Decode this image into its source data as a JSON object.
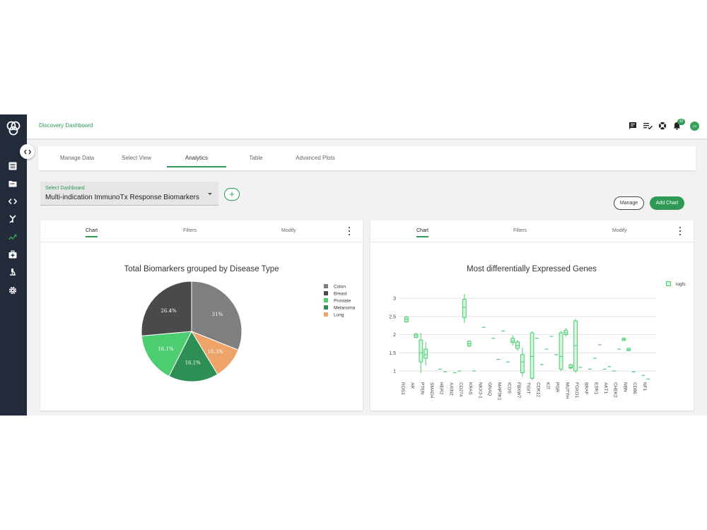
{
  "header": {
    "breadcrumb": "Discovery Dashboard",
    "notification_count": "93",
    "avatar_initials": "CD"
  },
  "tabs": [
    "Manage Data",
    "Select View",
    "Analytics",
    "Table",
    "Advanced Plots"
  ],
  "active_tab": "Analytics",
  "dashboard_select": {
    "label": "Select Dashboard",
    "value": "Multi-indication ImmunoTx Response Biomarkers"
  },
  "buttons": {
    "add_dashboard": "+",
    "manage": "Manage",
    "add_chart": "Add Chart"
  },
  "panel_tabs": {
    "chart": "Chart",
    "filters": "Filters",
    "modify": "Modify"
  },
  "colors": {
    "accent": "#2e9a55",
    "sidebar": "#232a3a"
  },
  "chart_data": [
    {
      "type": "pie",
      "title": "Total Biomarkers grouped by Disease Type",
      "labels": [
        "Colon",
        "Breast",
        "Prostate",
        "Melanoma",
        "Lung"
      ],
      "values": [
        31,
        26.4,
        16.1,
        16.1,
        10.3
      ],
      "slice_labels": [
        "31%",
        "26.4%",
        "16.1%",
        "16.1%",
        "10.3%"
      ],
      "slice_order": [
        "Colon",
        "Lung",
        "Melanoma",
        "Prostate",
        "Breast"
      ],
      "colors": {
        "Colon": "#7f7f7f",
        "Breast": "#4a4a4a",
        "Prostate": "#4ccd70",
        "Melanoma": "#2e8f55",
        "Lung": "#eea368"
      },
      "legend_position": "right"
    },
    {
      "type": "box",
      "title": "Most differentially Expressed Genes",
      "series_name": "logfc",
      "legend_position": "top-right",
      "ylim": [
        0.6,
        3.25
      ],
      "yticks": [
        1,
        1.5,
        2,
        2.5,
        3
      ],
      "ytick_labels": [
        "1",
        "1.5",
        "2",
        "2.5",
        "3"
      ],
      "categories": [
        "ROS1",
        "AR",
        "PTEN",
        "SMAD4",
        "HER2",
        "AXIN2",
        "CD274",
        "KRAS",
        "NKX3-1",
        "GNAQ",
        "MAP3K1",
        "ICOS",
        "FBXW7",
        "TIGIT",
        "CDK12",
        "KIT",
        "PGR",
        "MUTYH",
        "FOXO1",
        "BRAF",
        "ESR1",
        "AKT1",
        "CHEK2",
        "NBN",
        "CD86",
        "NF1"
      ],
      "boxes": [
        {
          "x": 0.5,
          "min": 2.32,
          "q1": 2.35,
          "median": 2.42,
          "q3": 2.48,
          "max": 2.52
        },
        {
          "x": 1.5,
          "min": 1.9,
          "q1": 1.92,
          "median": 1.97,
          "q3": 2.02,
          "max": 2.05
        },
        {
          "x": 2,
          "min": 0.95,
          "q1": 1.25,
          "median": 1.5,
          "q3": 1.85,
          "max": 2.05
        },
        {
          "x": 2.5,
          "min": 1.15,
          "q1": 1.35,
          "median": 1.45,
          "q3": 1.6,
          "max": 1.8
        },
        {
          "x": 4,
          "min": 1.05,
          "q1": 1.05,
          "median": 1.05,
          "q3": 1.05,
          "max": 1.05
        },
        {
          "x": 4.5,
          "min": 0.98,
          "q1": 0.98,
          "median": 0.98,
          "q3": 0.98,
          "max": 0.98
        },
        {
          "x": 5.5,
          "min": 0.95,
          "q1": 0.95,
          "median": 0.95,
          "q3": 0.95,
          "max": 0.95
        },
        {
          "x": 6,
          "min": 1.0,
          "q1": 1.0,
          "median": 1.0,
          "q3": 1.0,
          "max": 1.0
        },
        {
          "x": 6.5,
          "min": 2.32,
          "q1": 2.47,
          "median": 2.75,
          "q3": 2.97,
          "max": 3.12
        },
        {
          "x": 7,
          "min": 1.65,
          "q1": 1.69,
          "median": 1.75,
          "q3": 1.82,
          "max": 1.84
        },
        {
          "x": 7.5,
          "min": 1.0,
          "q1": 1.0,
          "median": 1.0,
          "q3": 1.0,
          "max": 1.0
        },
        {
          "x": 8.5,
          "min": 2.2,
          "q1": 2.2,
          "median": 2.2,
          "q3": 2.2,
          "max": 2.2
        },
        {
          "x": 9.5,
          "min": 1.9,
          "q1": 1.9,
          "median": 1.9,
          "q3": 1.9,
          "max": 1.9
        },
        {
          "x": 10,
          "min": 1.32,
          "q1": 1.32,
          "median": 1.32,
          "q3": 1.32,
          "max": 1.32
        },
        {
          "x": 10.5,
          "min": 2.1,
          "q1": 2.1,
          "median": 2.1,
          "q3": 2.1,
          "max": 2.1
        },
        {
          "x": 11,
          "min": 1.25,
          "q1": 1.25,
          "median": 1.25,
          "q3": 1.25,
          "max": 1.25
        },
        {
          "x": 11.5,
          "min": 1.7,
          "q1": 1.78,
          "median": 1.82,
          "q3": 1.9,
          "max": 1.98
        },
        {
          "x": 12,
          "min": 1.55,
          "q1": 1.62,
          "median": 1.7,
          "q3": 1.8,
          "max": 1.85
        },
        {
          "x": 12.5,
          "min": 0.85,
          "q1": 0.95,
          "median": 1.25,
          "q3": 1.45,
          "max": 1.65
        },
        {
          "x": 13.5,
          "min": 0.75,
          "q1": 0.8,
          "median": 1.4,
          "q3": 2.05,
          "max": 2.08
        },
        {
          "x": 14,
          "min": 1.9,
          "q1": 1.9,
          "median": 1.9,
          "q3": 1.9,
          "max": 1.9
        },
        {
          "x": 14.5,
          "min": 1.18,
          "q1": 1.18,
          "median": 1.18,
          "q3": 1.18,
          "max": 1.18
        },
        {
          "x": 15,
          "min": 1.6,
          "q1": 1.6,
          "median": 1.6,
          "q3": 1.6,
          "max": 1.6
        },
        {
          "x": 15.5,
          "min": 1.95,
          "q1": 1.95,
          "median": 1.95,
          "q3": 1.95,
          "max": 1.95
        },
        {
          "x": 16,
          "min": 1.45,
          "q1": 1.45,
          "median": 1.45,
          "q3": 1.45,
          "max": 1.45
        },
        {
          "x": 16.5,
          "min": 1.0,
          "q1": 1.05,
          "median": 1.4,
          "q3": 2.05,
          "max": 2.1
        },
        {
          "x": 17,
          "min": 1.95,
          "q1": 2.0,
          "median": 2.05,
          "q3": 2.12,
          "max": 2.18
        },
        {
          "x": 17.5,
          "min": 1.05,
          "q1": 1.08,
          "median": 1.1,
          "q3": 1.17,
          "max": 1.2
        },
        {
          "x": 18,
          "min": 0.95,
          "q1": 1.0,
          "median": 1.7,
          "q3": 2.38,
          "max": 2.42
        },
        {
          "x": 18.5,
          "min": 1.1,
          "q1": 1.1,
          "median": 1.1,
          "q3": 1.1,
          "max": 1.1
        },
        {
          "x": 19.5,
          "min": 1.05,
          "q1": 1.05,
          "median": 1.05,
          "q3": 1.05,
          "max": 1.05
        },
        {
          "x": 20,
          "min": 1.35,
          "q1": 1.35,
          "median": 1.35,
          "q3": 1.35,
          "max": 1.35
        },
        {
          "x": 20.5,
          "min": 1.72,
          "q1": 1.72,
          "median": 1.72,
          "q3": 1.72,
          "max": 1.72
        },
        {
          "x": 21,
          "min": 1.05,
          "q1": 1.05,
          "median": 1.05,
          "q3": 1.05,
          "max": 1.05
        },
        {
          "x": 21.5,
          "min": 1.12,
          "q1": 1.12,
          "median": 1.12,
          "q3": 1.12,
          "max": 1.12
        },
        {
          "x": 22,
          "min": 1.0,
          "q1": 1.0,
          "median": 1.0,
          "q3": 1.0,
          "max": 1.0
        },
        {
          "x": 22.5,
          "min": 1.6,
          "q1": 1.6,
          "median": 1.6,
          "q3": 1.6,
          "max": 1.6
        },
        {
          "x": 23,
          "min": 1.82,
          "q1": 1.84,
          "median": 1.87,
          "q3": 1.9,
          "max": 1.92
        },
        {
          "x": 23.5,
          "min": 1.55,
          "q1": 1.56,
          "median": 1.58,
          "q3": 1.62,
          "max": 1.64
        },
        {
          "x": 24,
          "min": 0.98,
          "q1": 0.98,
          "median": 0.98,
          "q3": 0.98,
          "max": 0.98
        },
        {
          "x": 25,
          "min": 0.88,
          "q1": 0.88,
          "median": 0.88,
          "q3": 0.88,
          "max": 0.88
        },
        {
          "x": 25.5,
          "min": 0.78,
          "q1": 0.78,
          "median": 0.78,
          "q3": 0.78,
          "max": 0.78
        }
      ]
    }
  ]
}
